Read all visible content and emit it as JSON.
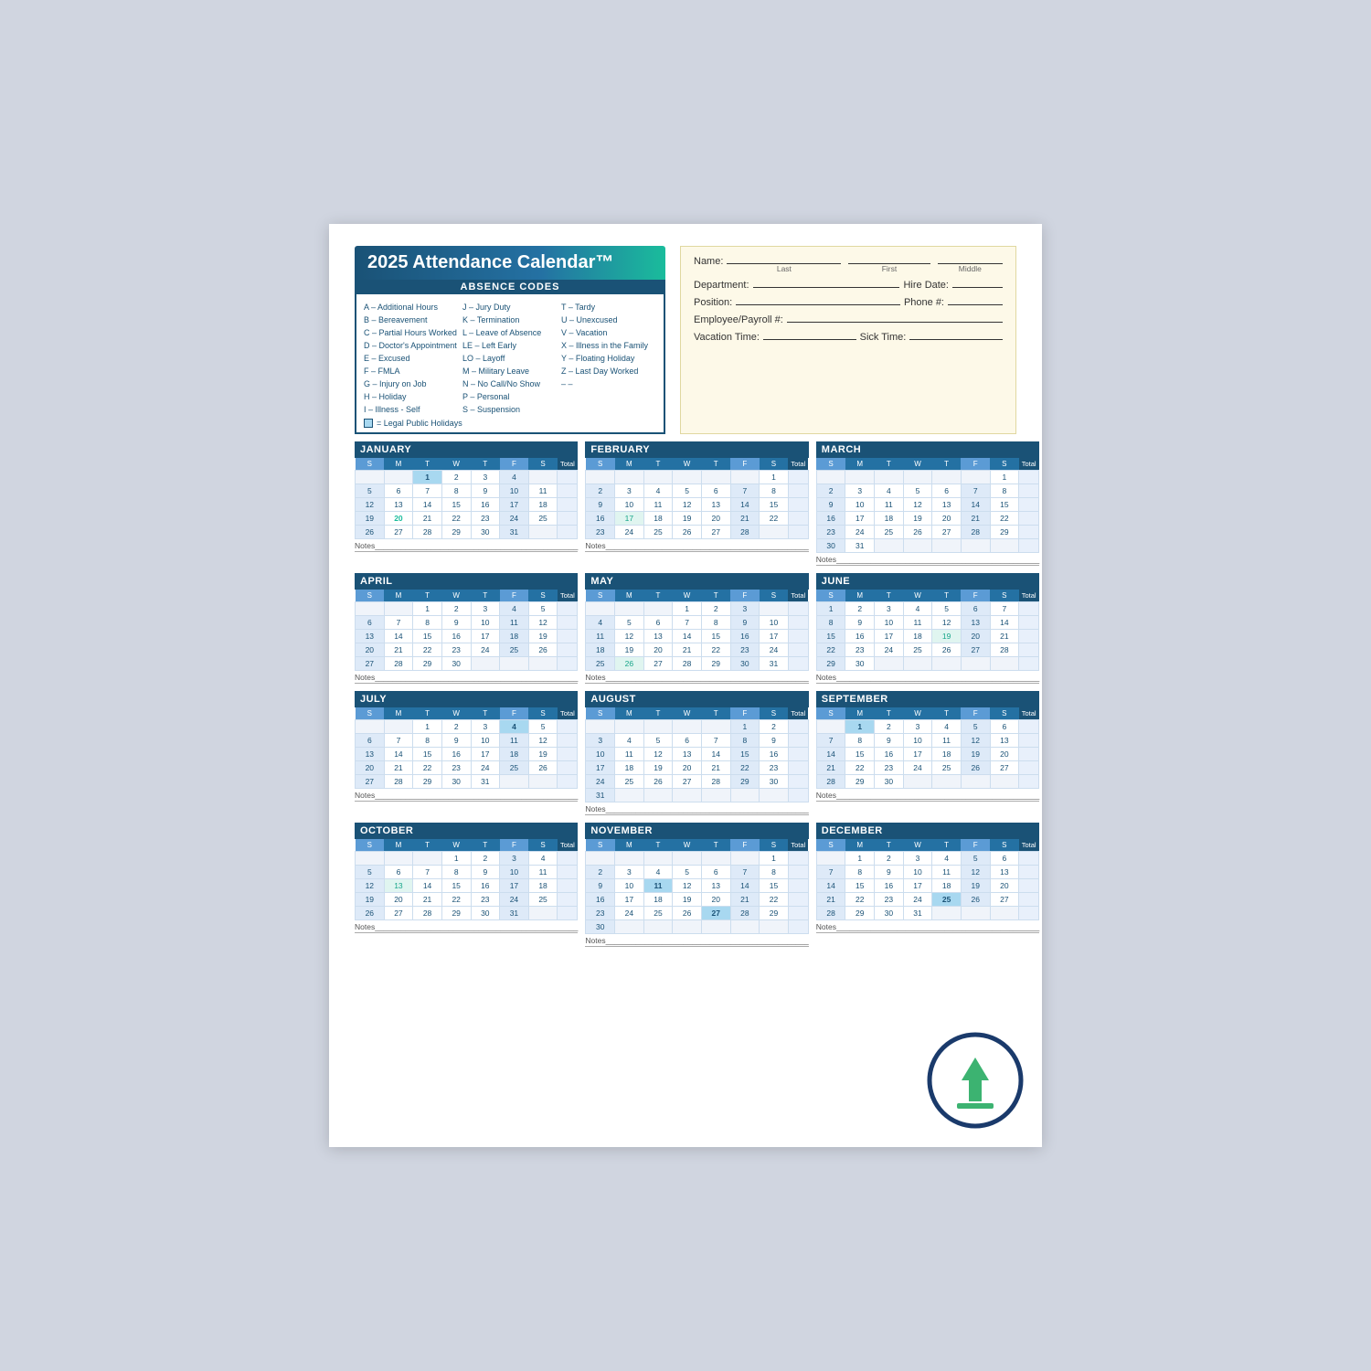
{
  "title": "2025 Attendance Calendar™",
  "absence_codes": {
    "header": "ABSENCE CODES",
    "col1": [
      "A – Additional Hours",
      "B – Bereavement",
      "C – Partial Hours Worked",
      "D – Doctor's Appointment",
      "E – Excused",
      "F – FMLA",
      "G – Injury on Job",
      "H – Holiday",
      "I  – Illness - Self"
    ],
    "col2": [
      "J  – Jury Duty",
      "K – Termination",
      "L  – Leave of Absence",
      "LE – Left Early",
      "LO – Layoff",
      "M – Military Leave",
      "N – No Call/No Show",
      "P  – Personal",
      "S  – Suspension"
    ],
    "col3": [
      "T  – Tardy",
      "U – Unexcused",
      "V – Vacation",
      "X – Illness in the Family",
      "Y – Floating Holiday",
      "Z – Last Day Worked",
      "– –",
      ""
    ],
    "holiday_note": "= Legal Public Holidays"
  },
  "form_fields": {
    "name_label": "Name:",
    "last_label": "Last",
    "first_label": "First",
    "middle_label": "Middle",
    "dept_label": "Department:",
    "hire_label": "Hire Date:",
    "position_label": "Position:",
    "phone_label": "Phone #:",
    "payroll_label": "Employee/Payroll #:",
    "vacation_label": "Vacation Time:",
    "sick_label": "Sick Time:"
  },
  "months": [
    {
      "name": "JANUARY",
      "days": [
        [
          "",
          "",
          "1",
          "2",
          "3",
          "4"
        ],
        [
          "5",
          "6",
          "7",
          "8",
          "9",
          "10",
          "11"
        ],
        [
          "12",
          "13",
          "14",
          "15",
          "16",
          "17",
          "18"
        ],
        [
          "19",
          "20",
          "21",
          "22",
          "23",
          "24",
          "25"
        ],
        [
          "26",
          "27",
          "28",
          "29",
          "30",
          "31",
          ""
        ]
      ],
      "holidays": [
        "1"
      ],
      "special": {
        "20": "green"
      }
    },
    {
      "name": "FEBRUARY",
      "days": [
        [
          "",
          "",
          "",
          "",
          "",
          "",
          "1"
        ],
        [
          "2",
          "3",
          "4",
          "5",
          "6",
          "7",
          "8"
        ],
        [
          "9",
          "10",
          "11",
          "12",
          "13",
          "14",
          "15"
        ],
        [
          "16",
          "17",
          "18",
          "19",
          "20",
          "21",
          "22"
        ],
        [
          "23",
          "24",
          "25",
          "26",
          "27",
          "28",
          ""
        ]
      ],
      "holidays": [],
      "special": {
        "17": "teal"
      }
    },
    {
      "name": "MARCH",
      "days": [
        [
          "",
          "",
          "",
          "",
          "",
          "",
          "1"
        ],
        [
          "2",
          "3",
          "4",
          "5",
          "6",
          "7",
          "8"
        ],
        [
          "9",
          "10",
          "11",
          "12",
          "13",
          "14",
          "15"
        ],
        [
          "16",
          "17",
          "18",
          "19",
          "20",
          "21",
          "22"
        ],
        [
          "23",
          "24",
          "25",
          "26",
          "27",
          "28",
          "29"
        ],
        [
          "30",
          "31",
          "",
          "",
          "",
          "",
          ""
        ]
      ],
      "holidays": [],
      "special": {}
    },
    {
      "name": "APRIL",
      "days": [
        [
          "",
          "",
          "1",
          "2",
          "3",
          "4",
          "5"
        ],
        [
          "6",
          "7",
          "8",
          "9",
          "10",
          "11",
          "12"
        ],
        [
          "13",
          "14",
          "15",
          "16",
          "17",
          "18",
          "19"
        ],
        [
          "20",
          "21",
          "22",
          "23",
          "24",
          "25",
          "26"
        ],
        [
          "27",
          "28",
          "29",
          "30",
          "",
          "",
          ""
        ]
      ],
      "holidays": [],
      "special": {}
    },
    {
      "name": "MAY",
      "days": [
        [
          "",
          "",
          "",
          "1",
          "2",
          "3",
          ""
        ],
        [
          "4",
          "5",
          "6",
          "7",
          "8",
          "9",
          "10"
        ],
        [
          "11",
          "12",
          "13",
          "14",
          "15",
          "16",
          "17"
        ],
        [
          "18",
          "19",
          "20",
          "21",
          "22",
          "23",
          "24"
        ],
        [
          "25",
          "26",
          "27",
          "28",
          "29",
          "30",
          "31"
        ]
      ],
      "holidays": [],
      "special": {
        "26": "teal"
      }
    },
    {
      "name": "JUNE",
      "days": [
        [
          "1",
          "2",
          "3",
          "4",
          "5",
          "6",
          "7"
        ],
        [
          "8",
          "9",
          "10",
          "11",
          "12",
          "13",
          "14"
        ],
        [
          "15",
          "16",
          "17",
          "18",
          "19",
          "20",
          "21"
        ],
        [
          "22",
          "23",
          "24",
          "25",
          "26",
          "27",
          "28"
        ],
        [
          "29",
          "30",
          "",
          "",
          "",
          "",
          ""
        ]
      ],
      "holidays": [],
      "special": {
        "19": "teal"
      }
    },
    {
      "name": "JULY",
      "days": [
        [
          "",
          "",
          "1",
          "2",
          "3",
          "4",
          "5"
        ],
        [
          "6",
          "7",
          "8",
          "9",
          "10",
          "11",
          "12"
        ],
        [
          "13",
          "14",
          "15",
          "16",
          "17",
          "18",
          "19"
        ],
        [
          "20",
          "21",
          "22",
          "23",
          "24",
          "25",
          "26"
        ],
        [
          "27",
          "28",
          "29",
          "30",
          "31",
          "",
          ""
        ]
      ],
      "holidays": [
        "4"
      ],
      "special": {
        "4": "holiday"
      }
    },
    {
      "name": "AUGUST",
      "days": [
        [
          "",
          "",
          "",
          "",
          "",
          "1",
          "2"
        ],
        [
          "3",
          "4",
          "5",
          "6",
          "7",
          "8",
          "9"
        ],
        [
          "10",
          "11",
          "12",
          "13",
          "14",
          "15",
          "16"
        ],
        [
          "17",
          "18",
          "19",
          "20",
          "21",
          "22",
          "23"
        ],
        [
          "24",
          "25",
          "26",
          "27",
          "28",
          "29",
          "30"
        ],
        [
          "31",
          "",
          "",
          "",
          "",
          "",
          ""
        ]
      ],
      "holidays": [],
      "special": {}
    },
    {
      "name": "SEPTEMBER",
      "days": [
        [
          "",
          "1",
          "2",
          "3",
          "4",
          "5",
          "6"
        ],
        [
          "7",
          "8",
          "9",
          "10",
          "11",
          "12",
          "13"
        ],
        [
          "14",
          "15",
          "16",
          "17",
          "18",
          "19",
          "20"
        ],
        [
          "21",
          "22",
          "23",
          "24",
          "25",
          "26",
          "27"
        ],
        [
          "28",
          "29",
          "30",
          "",
          "",
          "",
          ""
        ]
      ],
      "holidays": [
        "1"
      ],
      "special": {
        "1": "holiday"
      }
    },
    {
      "name": "OCTOBER",
      "days": [
        [
          "",
          "",
          "",
          "1",
          "2",
          "3",
          "4"
        ],
        [
          "5",
          "6",
          "7",
          "8",
          "9",
          "10",
          "11"
        ],
        [
          "12",
          "13",
          "14",
          "15",
          "16",
          "17",
          "18"
        ],
        [
          "19",
          "20",
          "21",
          "22",
          "23",
          "24",
          "25"
        ],
        [
          "26",
          "27",
          "28",
          "29",
          "30",
          "31",
          ""
        ]
      ],
      "holidays": [],
      "special": {
        "13": "teal"
      }
    },
    {
      "name": "NOVEMBER",
      "days": [
        [
          "",
          "",
          "",
          "",
          "",
          "",
          "1"
        ],
        [
          "2",
          "3",
          "4",
          "5",
          "6",
          "7",
          "8"
        ],
        [
          "9",
          "10",
          "11",
          "12",
          "13",
          "14",
          "15"
        ],
        [
          "16",
          "17",
          "18",
          "19",
          "20",
          "21",
          "22"
        ],
        [
          "23",
          "24",
          "25",
          "26",
          "27",
          "28",
          "29"
        ],
        [
          "30",
          "",
          "",
          "",
          "",
          "",
          ""
        ]
      ],
      "holidays": [
        "11",
        "27"
      ],
      "special": {
        "11": "teal",
        "27": "teal"
      }
    },
    {
      "name": "DECEMBER",
      "days": [
        [
          "",
          "1",
          "2",
          "3",
          "4",
          "5",
          "6"
        ],
        [
          "7",
          "8",
          "9",
          "10",
          "11",
          "12",
          "13"
        ],
        [
          "14",
          "15",
          "16",
          "17",
          "18",
          "19",
          "20"
        ],
        [
          "21",
          "22",
          "23",
          "24",
          "25",
          "26",
          "27"
        ],
        [
          "28",
          "29",
          "30",
          "31",
          "",
          "",
          ""
        ]
      ],
      "holidays": [
        "25"
      ],
      "special": {
        "25": "holiday"
      }
    }
  ],
  "notes_label": "Notes",
  "download_icon": "⬇"
}
